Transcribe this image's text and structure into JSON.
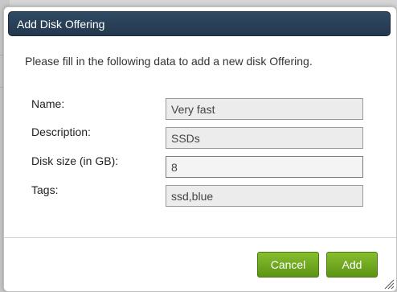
{
  "dialog": {
    "title": "Add Disk Offering",
    "intro": "Please fill in the following data to add a new disk Offering."
  },
  "form": {
    "name_label": "Name:",
    "name_value": "Very fast",
    "description_label": "Description:",
    "description_value": "SSDs",
    "disksize_label": "Disk size (in GB):",
    "disksize_value": "8",
    "tags_label": "Tags:",
    "tags_value": "ssd,blue"
  },
  "buttons": {
    "cancel_label": "Cancel",
    "add_label": "Add"
  },
  "colors": {
    "titlebar": "#2a4259",
    "button_green": "#6ea51f"
  },
  "icons": {
    "resize": "resize-grip-icon"
  }
}
